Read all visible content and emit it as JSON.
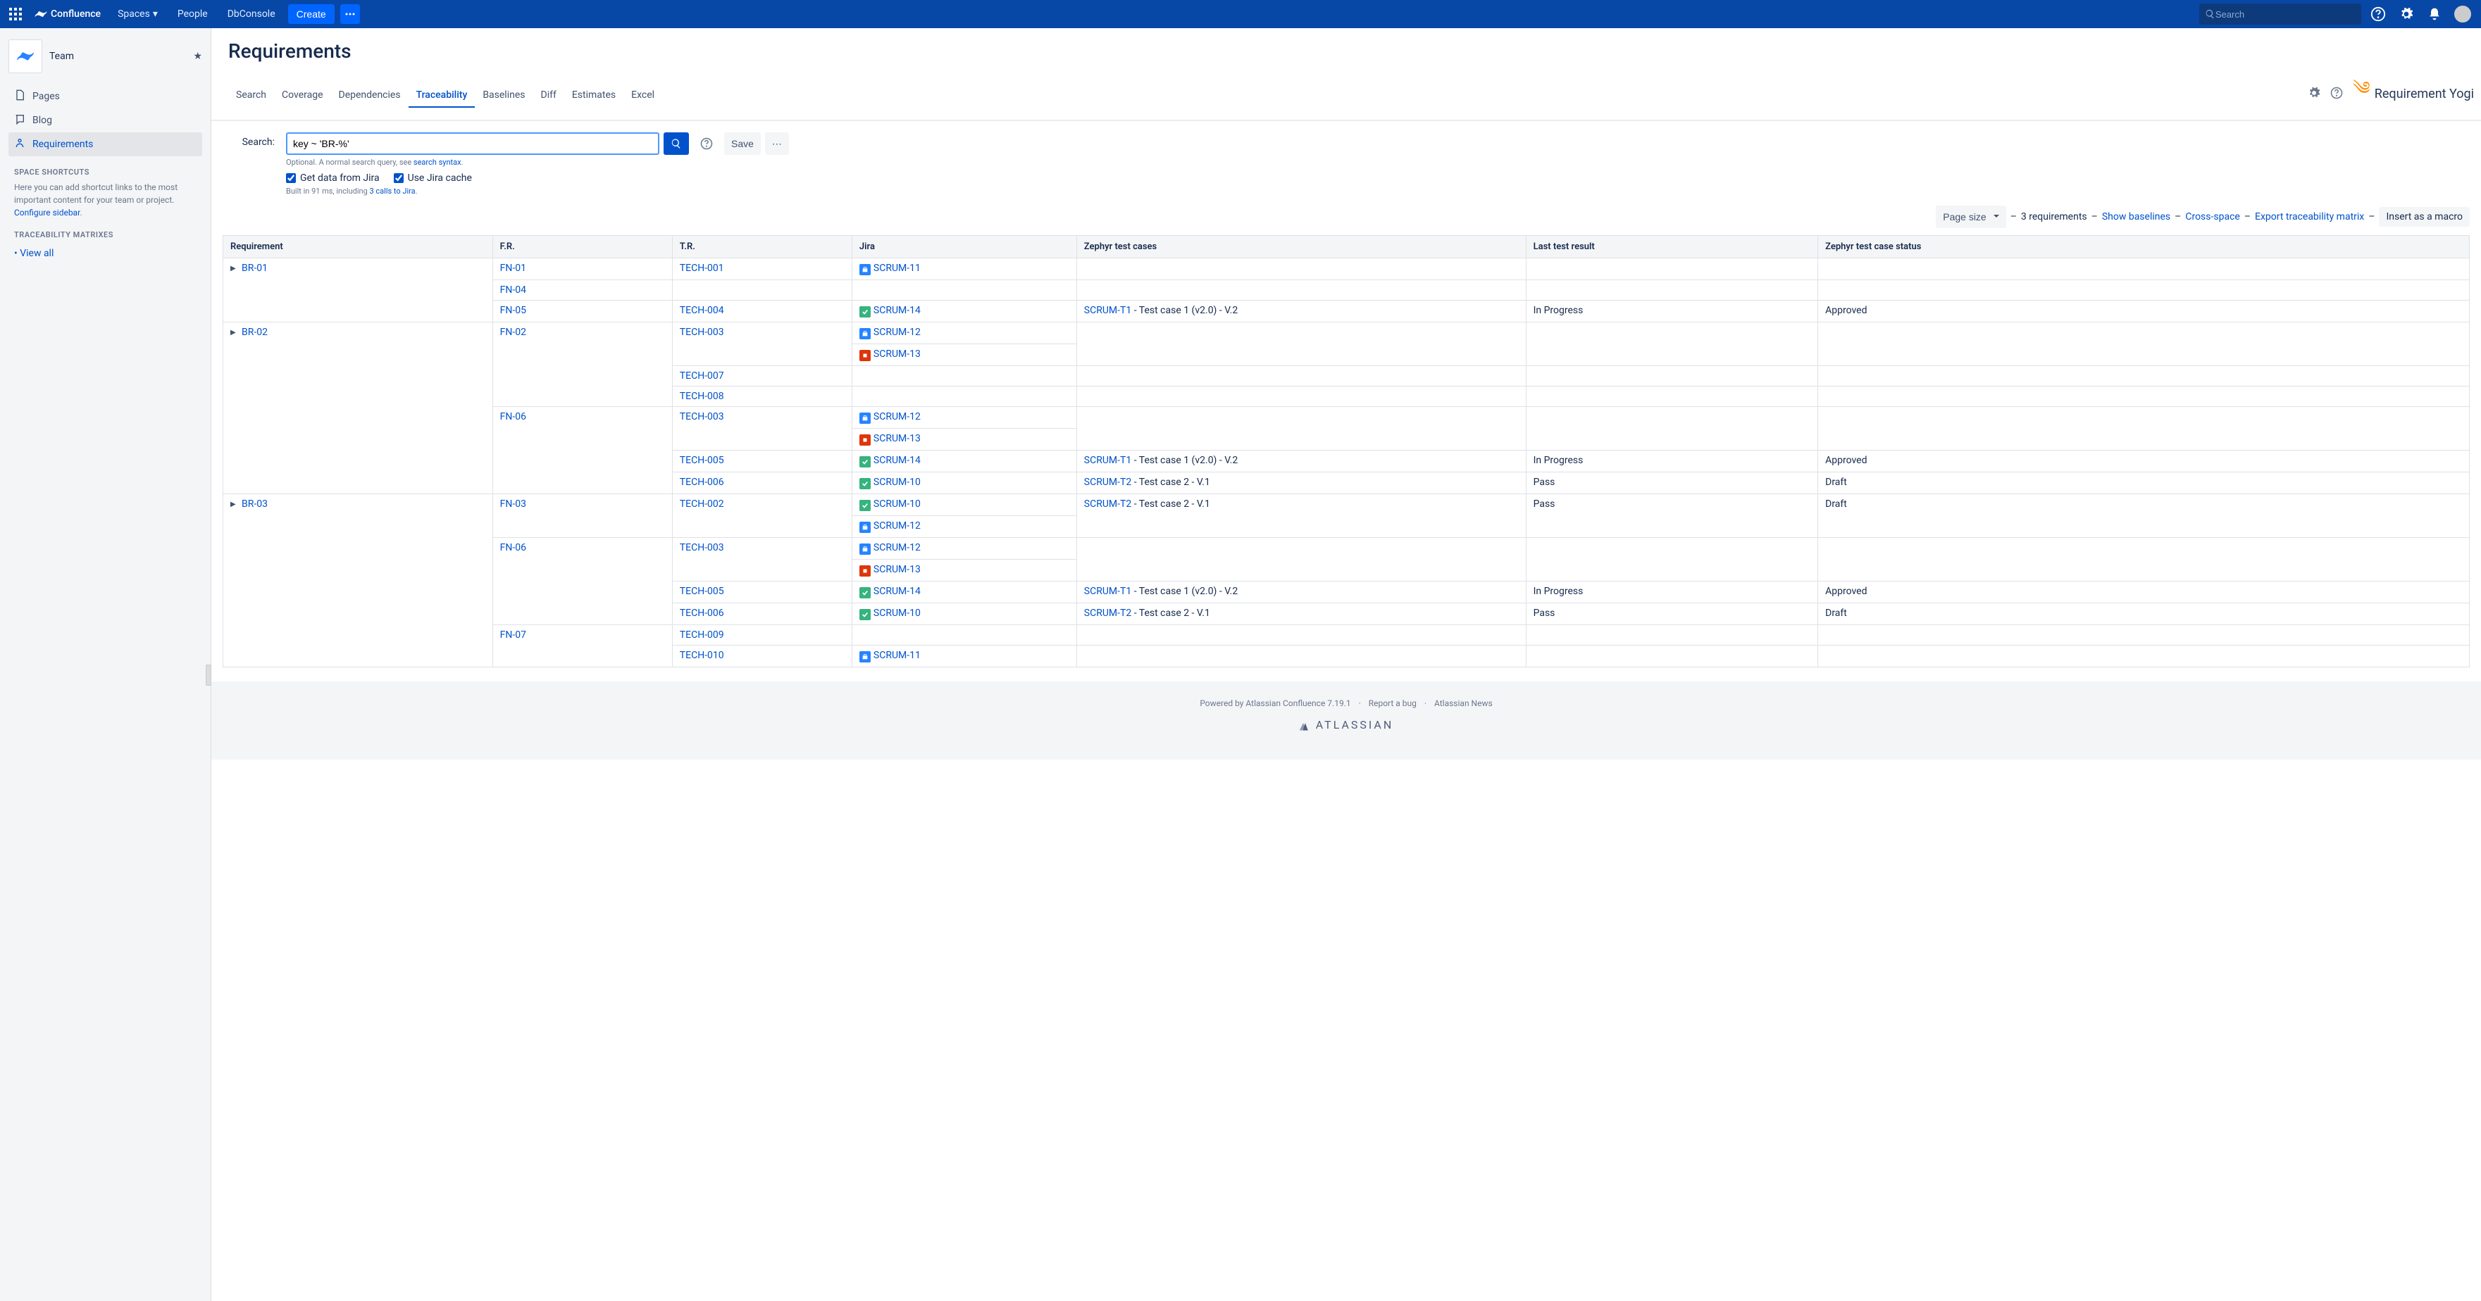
{
  "topnav": {
    "product": "Confluence",
    "links": [
      "Spaces",
      "People",
      "DbConsole"
    ],
    "create": "Create",
    "search_placeholder": "Search"
  },
  "sidebar": {
    "space_name": "Team",
    "items": [
      {
        "label": "Pages",
        "icon": "pages"
      },
      {
        "label": "Blog",
        "icon": "blog"
      },
      {
        "label": "Requirements",
        "icon": "req",
        "active": true
      }
    ],
    "shortcuts_heading": "SPACE SHORTCUTS",
    "shortcuts_text": "Here you can add shortcut links to the most important content for your team or project. ",
    "configure_link": "Configure sidebar",
    "matrix_heading": "TRACEABILITY MATRIXES",
    "view_all": "View all"
  },
  "page": {
    "title": "Requirements",
    "tabs": [
      "Search",
      "Coverage",
      "Dependencies",
      "Traceability",
      "Baselines",
      "Diff",
      "Estimates",
      "Excel"
    ],
    "active_tab": "Traceability",
    "ry_logo": "Requirement Yogi"
  },
  "search": {
    "label": "Search:",
    "query": "key ~ 'BR-%'",
    "hint_prefix": "Optional. A normal search query, see ",
    "hint_link": "search syntax",
    "get_jira": "Get data from Jira",
    "use_cache": "Use Jira cache",
    "save": "Save",
    "build_prefix": "Built in 91 ms, including ",
    "build_link": "3 calls to Jira"
  },
  "toolbar": {
    "page_size": "Page size",
    "count": "3 requirements",
    "show_baselines": "Show baselines",
    "cross_space": "Cross-space",
    "export": "Export traceability matrix",
    "insert_macro": "Insert as a macro"
  },
  "columns": [
    "Requirement",
    "F.R.",
    "T.R.",
    "Jira",
    "Zephyr test cases",
    "Last test result",
    "Zephyr test case status"
  ],
  "col_widths": [
    "12%",
    "8%",
    "8%",
    "10%",
    "20%",
    "13%",
    "29%"
  ],
  "groups": [
    {
      "req": "BR-01",
      "frs": [
        {
          "fr": "FN-01",
          "trs": [
            {
              "tr": "TECH-001",
              "jira": [
                {
                  "key": "SCRUM-11",
                  "color": "blue"
                }
              ],
              "zephyr": "",
              "result": "",
              "status": ""
            }
          ]
        },
        {
          "fr": "FN-04",
          "trs": [
            {
              "tr": "",
              "jira": [],
              "zephyr": "",
              "result": "",
              "status": ""
            }
          ]
        },
        {
          "fr": "FN-05",
          "trs": [
            {
              "tr": "TECH-004",
              "jira": [
                {
                  "key": "SCRUM-14",
                  "color": "green"
                }
              ],
              "zephyr_link": "SCRUM-T1",
              "zephyr_text": " - Test case 1 (v2.0) - V.2",
              "result": "In Progress",
              "status": "Approved"
            }
          ]
        }
      ]
    },
    {
      "req": "BR-02",
      "frs": [
        {
          "fr": "FN-02",
          "trs": [
            {
              "tr": "TECH-003",
              "jira": [
                {
                  "key": "SCRUM-12",
                  "color": "blue"
                },
                {
                  "key": "SCRUM-13",
                  "color": "red"
                }
              ],
              "zephyr": "",
              "result": "",
              "status": ""
            },
            {
              "tr": "TECH-007",
              "jira": [],
              "zephyr": "",
              "result": "",
              "status": ""
            },
            {
              "tr": "TECH-008",
              "jira": [],
              "zephyr": "",
              "result": "",
              "status": ""
            }
          ]
        },
        {
          "fr": "FN-06",
          "trs": [
            {
              "tr": "TECH-003",
              "jira": [
                {
                  "key": "SCRUM-12",
                  "color": "blue"
                },
                {
                  "key": "SCRUM-13",
                  "color": "red"
                }
              ],
              "zephyr": "",
              "result": "",
              "status": ""
            },
            {
              "tr": "TECH-005",
              "jira": [
                {
                  "key": "SCRUM-14",
                  "color": "green"
                }
              ],
              "zephyr_link": "SCRUM-T1",
              "zephyr_text": " - Test case 1 (v2.0) - V.2",
              "result": "In Progress",
              "status": "Approved"
            },
            {
              "tr": "TECH-006",
              "jira": [
                {
                  "key": "SCRUM-10",
                  "color": "green"
                }
              ],
              "zephyr_link": "SCRUM-T2",
              "zephyr_text": " - Test case 2 - V.1",
              "result": "Pass",
              "status": "Draft"
            }
          ]
        }
      ]
    },
    {
      "req": "BR-03",
      "frs": [
        {
          "fr": "FN-03",
          "trs": [
            {
              "tr": "TECH-002",
              "jira": [
                {
                  "key": "SCRUM-10",
                  "color": "green"
                },
                {
                  "key": "SCRUM-12",
                  "color": "blue"
                }
              ],
              "zephyr_link": "SCRUM-T2",
              "zephyr_text": " - Test case 2 - V.1",
              "result": "Pass",
              "status": "Draft"
            }
          ]
        },
        {
          "fr": "FN-06",
          "trs": [
            {
              "tr": "TECH-003",
              "jira": [
                {
                  "key": "SCRUM-12",
                  "color": "blue"
                },
                {
                  "key": "SCRUM-13",
                  "color": "red"
                }
              ],
              "zephyr": "",
              "result": "",
              "status": ""
            },
            {
              "tr": "TECH-005",
              "jira": [
                {
                  "key": "SCRUM-14",
                  "color": "green"
                }
              ],
              "zephyr_link": "SCRUM-T1",
              "zephyr_text": " - Test case 1 (v2.0) - V.2",
              "result": "In Progress",
              "status": "Approved"
            },
            {
              "tr": "TECH-006",
              "jira": [
                {
                  "key": "SCRUM-10",
                  "color": "green"
                }
              ],
              "zephyr_link": "SCRUM-T2",
              "zephyr_text": " - Test case 2 - V.1",
              "result": "Pass",
              "status": "Draft"
            }
          ]
        },
        {
          "fr": "FN-07",
          "trs": [
            {
              "tr": "TECH-009",
              "jira": [],
              "zephyr": "",
              "result": "",
              "status": ""
            },
            {
              "tr": "TECH-010",
              "jira": [
                {
                  "key": "SCRUM-11",
                  "color": "blue"
                }
              ],
              "zephyr": "",
              "result": "",
              "status": ""
            }
          ]
        }
      ]
    }
  ],
  "footer": {
    "powered": "Powered by ",
    "conf": "Atlassian Confluence",
    "version": " 7.19.1",
    "report": "Report a bug",
    "news": "Atlassian News",
    "atlassian": "ATLASSIAN"
  }
}
